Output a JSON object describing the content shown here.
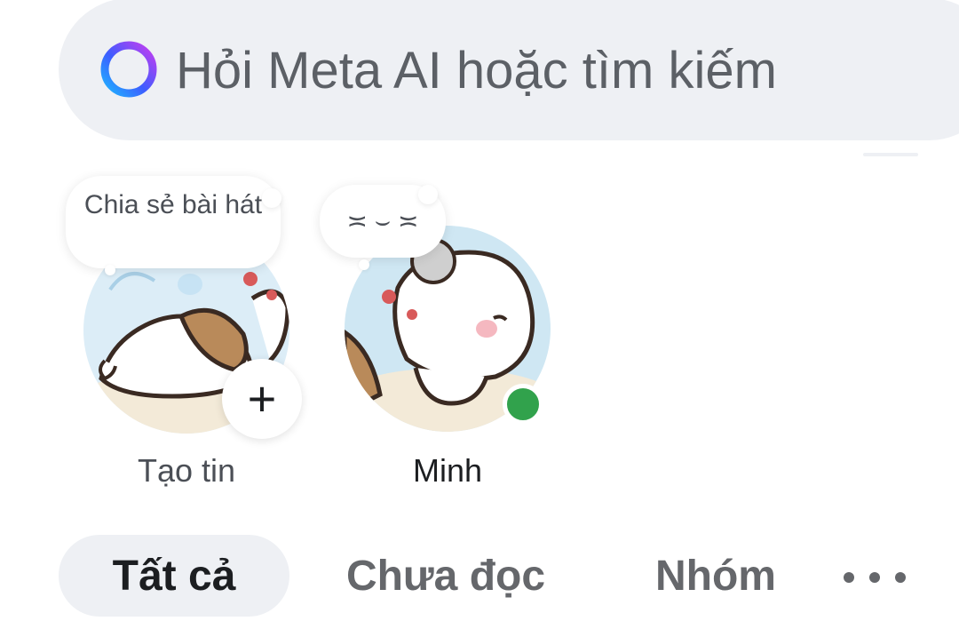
{
  "search": {
    "placeholder": "Hỏi Meta AI hoặc tìm kiếm",
    "icon": "meta-ai-ring-icon"
  },
  "stories": [
    {
      "label": "Tạo tin",
      "note": "Chia sẻ bài hát",
      "action_icon": "plus-icon",
      "action_glyph": "+"
    },
    {
      "label": "Minh",
      "note": "≍ ⌣ ≍",
      "online": true
    }
  ],
  "tabs": [
    {
      "label": "Tất cả",
      "active": true
    },
    {
      "label": "Chưa đọc",
      "active": false
    },
    {
      "label": "Nhóm",
      "active": false
    }
  ],
  "more_icon": "more-horizontal-icon",
  "colors": {
    "search_bg": "#eef0f4",
    "online": "#31a24c",
    "active_tab_bg": "#eef0f4",
    "text_primary": "#1c1e21",
    "text_secondary": "#65676b"
  }
}
